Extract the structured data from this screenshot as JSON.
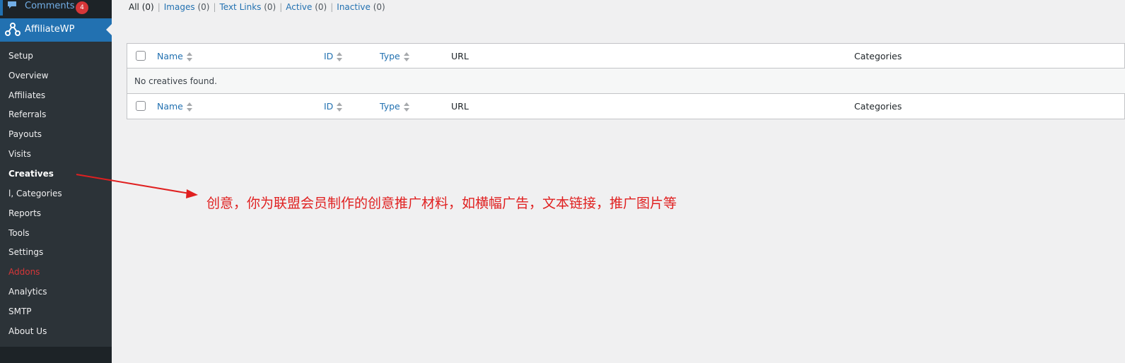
{
  "sidebar": {
    "comments": {
      "label": "Comments",
      "count": "4"
    },
    "plugin_title": "AffiliateWP",
    "items": [
      {
        "label": "Setup"
      },
      {
        "label": "Overview"
      },
      {
        "label": "Affiliates"
      },
      {
        "label": "Referrals"
      },
      {
        "label": "Payouts"
      },
      {
        "label": "Visits"
      },
      {
        "label": "Creatives"
      },
      {
        "label": "Categories"
      },
      {
        "label": "Reports"
      },
      {
        "label": "Tools"
      },
      {
        "label": "Settings"
      },
      {
        "label": "Addons"
      },
      {
        "label": "Analytics"
      },
      {
        "label": "SMTP"
      },
      {
        "label": "About Us"
      }
    ],
    "categories_prefix": "l,"
  },
  "filters": [
    {
      "label": "All",
      "count": "(0)"
    },
    {
      "label": "Images",
      "count": "(0)"
    },
    {
      "label": "Text Links",
      "count": "(0)"
    },
    {
      "label": "Active",
      "count": "(0)"
    },
    {
      "label": "Inactive",
      "count": "(0)"
    }
  ],
  "table": {
    "columns": {
      "name": "Name",
      "id": "ID",
      "type": "Type",
      "url": "URL",
      "categories": "Categories"
    },
    "empty_message": "No creatives found."
  },
  "annotation": {
    "text": "创意，你为联盟会员制作的创意推广材料，如横幅广告，文本链接，推广图片等"
  },
  "colors": {
    "sidebar_bg": "#1d2327",
    "submenu_bg": "#2c3338",
    "accent": "#2271b1",
    "badge": "#d63638",
    "annotation": "#e02020"
  }
}
